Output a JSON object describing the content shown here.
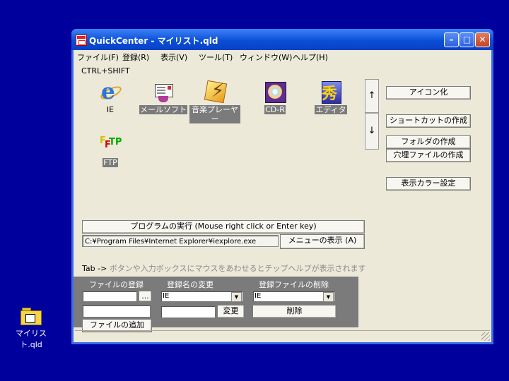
{
  "window": {
    "title": "QuickCenter - マイリスト.qld",
    "minimize": "–",
    "maximize": "□",
    "close": "✕"
  },
  "menu": [
    "ファイル(F)",
    "登録(R)",
    "表示(V)",
    "ツール(T)",
    "ウィンドウ(W)",
    "ヘルプ(H)"
  ],
  "hotkey_label": "CTRL+SHIFT",
  "programs": [
    {
      "label": "IE",
      "icon": "internet-explorer-icon",
      "selected": false
    },
    {
      "label": "メールソフト",
      "icon": "mail-software-icon",
      "selected": true
    },
    {
      "label": "音楽プレーヤー",
      "icon": "music-player-icon",
      "selected": true
    },
    {
      "label": "CD-R",
      "icon": "cd-r-icon",
      "selected": true
    },
    {
      "label": "エディタ",
      "icon": "editor-icon",
      "selected": true
    },
    {
      "label": "FTP",
      "icon": "ftp-icon",
      "selected": true
    }
  ],
  "arrows": {
    "up": "↑",
    "down": "↓"
  },
  "side_buttons": {
    "iconify": "アイコン化",
    "create_shortcut": "ショートカットの作成",
    "create_folder": "フォルダの作成",
    "create_hole_file": "穴埋ファイルの作成",
    "display_color": "表示カラー設定"
  },
  "execute_bar": "プログラムの実行 (Mouse right click or Enter key)",
  "path": "C:¥Program Files¥Internet Explorer¥iexplore.exe",
  "menu_display": "メニューの表示 (A)",
  "hint": {
    "prefix": "Tab ->",
    "text": "ボタンや入力ボックスにマウスをあわせるとチップヘルプが表示されます"
  },
  "panel": {
    "file_register_header": "ファイルの登録",
    "browse": "...",
    "add_file": "ファイルの追加",
    "rename_header": "登録名の変更",
    "rename_select": "IE",
    "change": "変更",
    "delete_header": "登録ファイルの削除",
    "delete_select": "IE",
    "delete": "削除"
  },
  "desktop": {
    "icon_label": "マイリスト.qld"
  }
}
